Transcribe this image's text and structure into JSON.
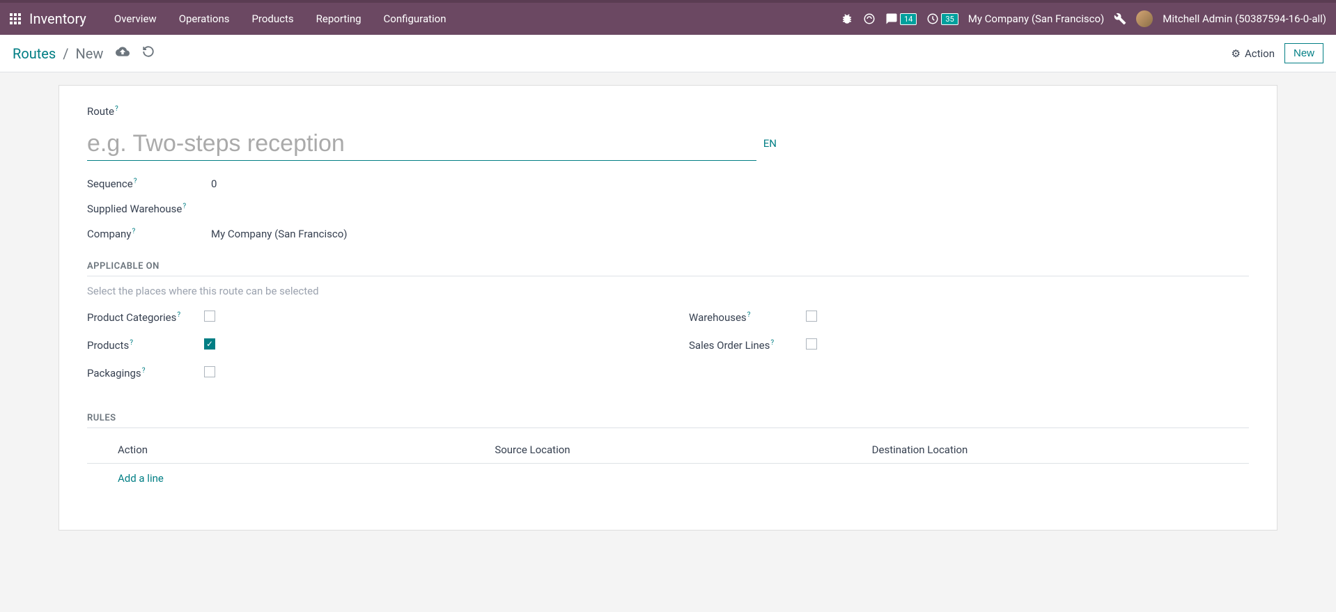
{
  "topbar": {
    "app_title": "Inventory",
    "menu": [
      "Overview",
      "Operations",
      "Products",
      "Reporting",
      "Configuration"
    ],
    "messages_badge": "14",
    "activities_badge": "35",
    "company": "My Company (San Francisco)",
    "user": "Mitchell Admin (50387594-16-0-all)"
  },
  "breadcrumb": {
    "parent": "Routes",
    "current": "New"
  },
  "controls": {
    "action_label": "Action",
    "new_label": "New"
  },
  "form": {
    "route_label": "Route",
    "route_placeholder": "e.g. Two-steps reception",
    "route_value": "",
    "lang": "EN",
    "sequence_label": "Sequence",
    "sequence_value": "0",
    "supplied_wh_label": "Supplied Warehouse",
    "supplied_wh_value": "",
    "company_label": "Company",
    "company_value": "My Company (San Francisco)"
  },
  "applicable": {
    "title": "APPLICABLE ON",
    "help": "Select the places where this route can be selected",
    "product_categories_label": "Product Categories",
    "product_categories_checked": false,
    "products_label": "Products",
    "products_checked": true,
    "packagings_label": "Packagings",
    "packagings_checked": false,
    "warehouses_label": "Warehouses",
    "warehouses_checked": false,
    "sales_order_lines_label": "Sales Order Lines",
    "sales_order_lines_checked": false
  },
  "rules": {
    "title": "RULES",
    "col_action": "Action",
    "col_source": "Source Location",
    "col_dest": "Destination Location",
    "add_line": "Add a line"
  }
}
